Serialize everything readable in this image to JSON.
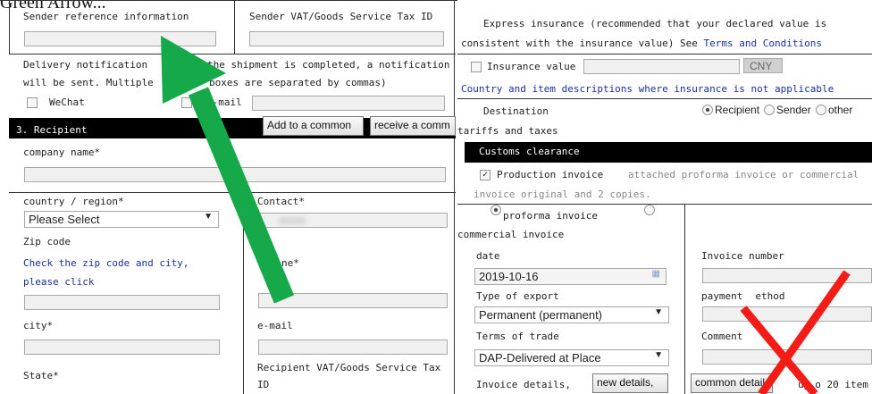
{
  "caption": "Green Arrow...",
  "left": {
    "sender_ref_label": "Sender reference information",
    "sender_vat_label": "Sender VAT/Goods Service Tax ID",
    "delivery_line1a": "Delivery notification",
    "delivery_line1b": "the shipment is completed, a notification",
    "delivery_line2a": "will be sent. Multiple",
    "delivery_line2b": "boxes are separated by commas)",
    "wechat_label": "WeChat",
    "email_opt_label": "e-mail",
    "recipient_header": "3. Recipient",
    "add_common_btn": "Add to a common",
    "receive_common_btn": "receive a comm",
    "company_label": "company name*",
    "country_label": "country / region*",
    "country_value": "Please Select",
    "contact_label": "Contact*",
    "zip_label": "Zip code",
    "zip_link1": "Check the zip code and city,",
    "zip_link2": "please click",
    "phone_label": "ne*",
    "city_label": "city*",
    "email_label": "e-mail",
    "state_label": "State*",
    "recip_vat_label1": "Recipient VAT/Goods Service Tax",
    "recip_vat_label2": "ID"
  },
  "right": {
    "insurance_line1": "Express insurance (recommended that your declared value is",
    "insurance_line2": "consistent with the insurance value) See",
    "terms_link": "Terms and Conditions",
    "insurance_value_label": "Insurance value",
    "currency": "CNY",
    "country_desc_line": "Country and item descriptions where insurance is not applicable",
    "destination_label": "Destination",
    "tariffs_label": "tariffs and taxes",
    "opt_recipient": "Recipient",
    "opt_sender": "Sender",
    "opt_other": "other",
    "customs_header": "Customs clearance",
    "production_invoice": "Production invoice",
    "attached_text": "attached proforma invoice or commercial",
    "attached_text2": "invoice original and 2 copies.",
    "proforma_label": "proforma invoice",
    "commercial_label": "commercial invoice",
    "date_label": "date",
    "date_value": "2019-10-16",
    "invoice_number_label": "Invoice number",
    "export_type_label": "Type of export",
    "export_type_value": "Permanent (permanent)",
    "payment_label_a": "payment",
    "payment_label_b": "ethod",
    "terms_trade_label": "Terms of trade",
    "terms_trade_value": "DAP-Delivered at Place",
    "comment_label": "Comment",
    "invoice_details_label": "Invoice details,",
    "new_details_btn": "new details,",
    "common_details_btn": "common detail",
    "up_to_a": "up",
    "up_to_b": "o 20 item"
  },
  "overlays": {
    "green_arrow_color": "#16a94a",
    "red_x_color": "#f41c17"
  }
}
